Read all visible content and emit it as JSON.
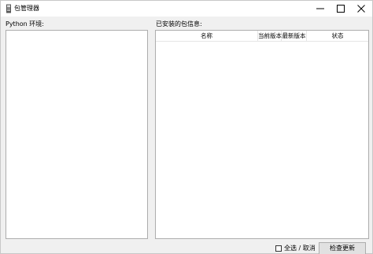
{
  "window": {
    "title": "包管理器",
    "icon": "package-manager-icon"
  },
  "left": {
    "label": "Python 环境:"
  },
  "right": {
    "label": "已安装的包信息:",
    "columns": [
      "名称",
      "当前版本",
      "最新版本",
      "状态"
    ]
  },
  "footer": {
    "select_all_label": "全选 / 取消",
    "select_all_checked": false,
    "update_button_label": "检查更新"
  }
}
